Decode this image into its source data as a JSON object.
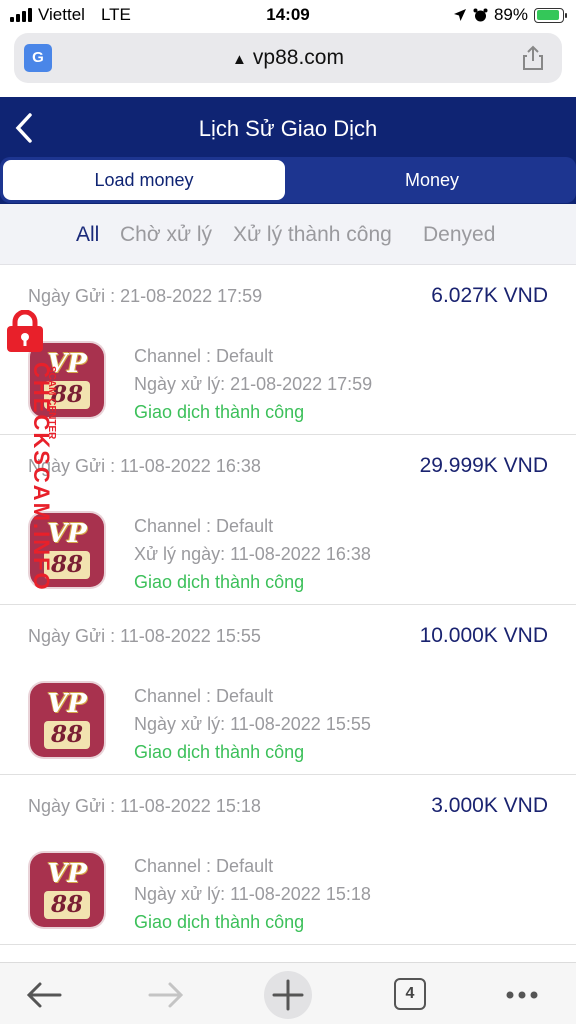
{
  "status_bar": {
    "carrier": "Viettel",
    "network": "LTE",
    "time": "14:09",
    "battery": "89%"
  },
  "browser": {
    "url": "vp88.com",
    "tab_count": "4"
  },
  "header": {
    "title": "Lịch Sử Giao Dịch"
  },
  "tabs": [
    {
      "label": "Load money"
    },
    {
      "label": "Money"
    }
  ],
  "filters": [
    {
      "label": "All"
    },
    {
      "label": "Chờ xử lý"
    },
    {
      "label": "Xử lý thành công"
    },
    {
      "label": "Denyed"
    }
  ],
  "logo": {
    "line1": "VP",
    "line2": "88"
  },
  "transactions": [
    {
      "sent": "Ngày Gửi : 21-08-2022 17:59",
      "amount": "6.027K VND",
      "channel": "Channel : Default",
      "processed": "Ngày xử lý: 21-08-2022 17:59",
      "status": "Giao dịch thành công"
    },
    {
      "sent": "Ngày Gửi : 11-08-2022 16:38",
      "amount": "29.999K VND",
      "channel": "Channel : Default",
      "processed": "Xử lý ngày: 11-08-2022 16:38",
      "status": "Giao dịch thành công"
    },
    {
      "sent": "Ngày Gửi : 11-08-2022 15:55",
      "amount": "10.000K VND",
      "channel": "Channel : Default",
      "processed": "Ngày xử lý: 11-08-2022 15:55",
      "status": "Giao dịch thành công"
    },
    {
      "sent": "Ngày Gửi : 11-08-2022 15:18",
      "amount": "3.000K VND",
      "channel": "Channel : Default",
      "processed": "Ngày xử lý: 11-08-2022 15:18",
      "status": "Giao dịch thành công"
    }
  ],
  "watermark": {
    "text": "CHECKSCAM.INFO",
    "subtext": "SCAM CENTER"
  },
  "colors": {
    "header": "#0f2473",
    "accent": "#1a2370",
    "success": "#3cc05a",
    "logo": "#a8324e",
    "watermark": "#e8202a"
  }
}
